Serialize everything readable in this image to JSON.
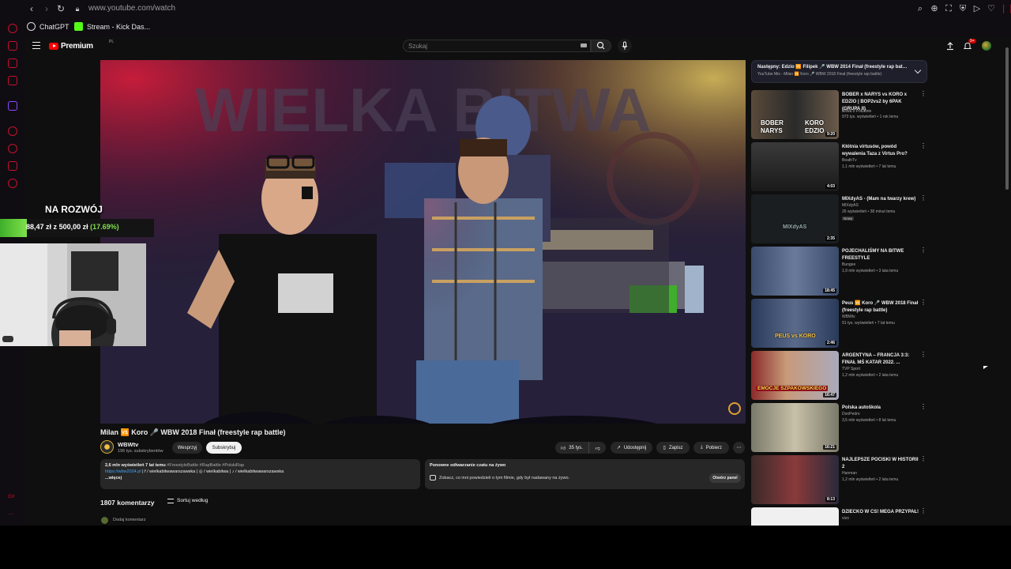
{
  "browser": {
    "url": "www.youtube.com/watch",
    "bookmarks": [
      {
        "label": "ChatGPT"
      },
      {
        "label": "Stream - Kick Das..."
      }
    ]
  },
  "header": {
    "logo_text": "Premium",
    "logo_region": "PL",
    "search_placeholder": "Szukaj",
    "notification_count": "9+"
  },
  "video": {
    "title": "Milan 🆚 Koro 🎤 WBW 2018 Finał (freestyle rap battle)",
    "channel": "WBWtv",
    "subscribers": "196 tys. subskrybentów",
    "join_label": "Wesprzyj",
    "subscribe_label": "Subskrybuj",
    "likes": "35 tys.",
    "share_label": "Udostępnij",
    "save_label": "Zapisz",
    "download_label": "Pobierz",
    "watermark": "WIELKA BITWA"
  },
  "description": {
    "meta": "2,6 mln wyświetleń  7 lat temu",
    "tags": "#FreestyleBattle #RapBattle #PolskiRap",
    "link": "https://wbw2024.pl",
    "socials": "| f / wielkabitwawarszawska | ◎ / wielkabitwa | ♪ / wielkabitwawarszawska",
    "more": "...więcej"
  },
  "chat_replay": {
    "title": "Ponowne odtwarzanie czatu na żywo",
    "desc": "Zobacz, co inni powiedzieli o tym filmie, gdy był nadawany na żywo.",
    "open_label": "Otwórz panel"
  },
  "comments": {
    "count": "1807 komentarzy",
    "sort_label": "Sortuj według",
    "add_placeholder": "Dodaj komentarz"
  },
  "up_next": {
    "title": "Następny: Edzio 🆚 Filipek 🎤 WBW 2014 Finał (freestyle rap battl...",
    "sub": "YouTube Mix - Milan 🆚 Koro 🎤 WBW 2018 Finał (freestyle rap battle)"
  },
  "recommendations": [
    {
      "title": "BOBER x NARYS vs KORO x EDZIO | BOP2vs2 by 6PAK (GRUPA II)",
      "channel": "Bitwa o Południe",
      "views": "973 tys. wyświetleń • 1 rok temu",
      "duration": "9:20",
      "thumb_caption_left": "BOBER NARYS",
      "thumb_caption_right": "KORO EDZIO"
    },
    {
      "title": "Kłótnia virtusów, powód wywalenia Taza z Virtus Pro?",
      "channel": "BeathTv",
      "views": "1,1 mln wyświetleń • 7 lat temu",
      "duration": "4:03"
    },
    {
      "title": "MIXdyAS - (Mam na twarzy krew)",
      "channel": "MIXdyAS",
      "views": "26 wyświetleń • 38 minut temu",
      "duration": "2:35",
      "badge": "Nowy",
      "thumb_caption_left": "MIXdyAS"
    },
    {
      "title": "POJECHALIŚMY NA BITWE FREESTYLE",
      "channel": "Bungee",
      "views": "1,9 mln wyświetleń • 3 lata temu",
      "duration": "18:45"
    },
    {
      "title": "Peus 🆚 Koro 🎤 WBW 2018 Finał (freestyle rap battle)",
      "channel": "WBWtv",
      "views": "91 tys. wyświetleń • 7 lat temu",
      "duration": "2:46",
      "thumb_caption_left": "PEUS vs KORO"
    },
    {
      "title": "ARGENTYNA – FRANCJA 3:3: FINAŁ MŚ KATAR 2022. ...",
      "channel": "TVP Sport",
      "views": "1,2 mln wyświetleń • 2 lata temu",
      "duration": "16:47",
      "thumb_caption_left": "EMOCJE SZPAKOWSKIEGO"
    },
    {
      "title": "Polska autoškola",
      "channel": "DonPedro",
      "views": "3,5 mln wyświetleń • 8 lat temu",
      "duration": "16:21"
    },
    {
      "title": "NAJLEPSZE POCISKI W HISTORII 2",
      "channel": "Hanman",
      "views": "1,2 mln wyświetleń • 2 lata temu",
      "duration": "8:13"
    },
    {
      "title": "DZIECKO W CS! MEGA PRZYPAŁ!",
      "channel": "vizo",
      "views": "",
      "duration": ""
    }
  ],
  "overlay": {
    "goal_label": "NA ROZWÓJ",
    "raised": "88,47 zł",
    "of": "z",
    "target": "500,00 zł",
    "percent_text": "(17.69%)",
    "progress": 0.1769,
    "accent": "#7ee04a"
  },
  "icons": {
    "back": "back-icon",
    "forward": "forward-icon",
    "reload": "reload-icon",
    "secure": "lock-icon",
    "search": "search-icon",
    "mic": "mic-icon",
    "upload": "upload-icon",
    "bell": "bell-icon",
    "menu": "hamburger-icon"
  }
}
